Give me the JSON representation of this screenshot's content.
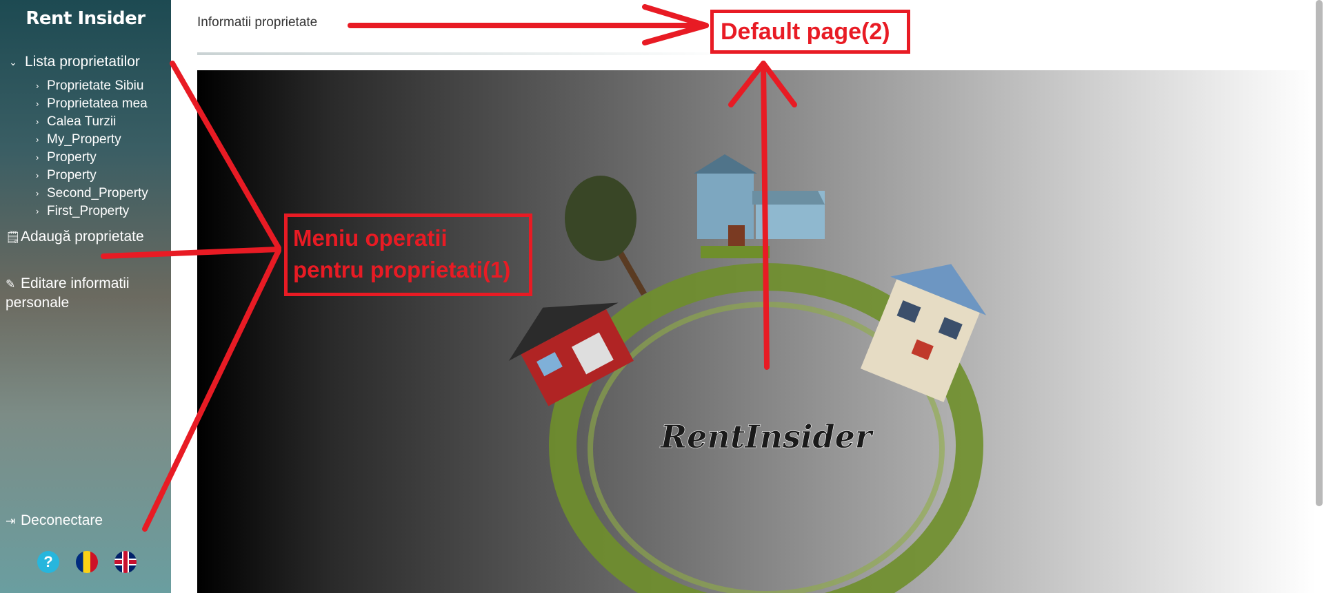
{
  "sidebar": {
    "brand": "Rent Insider",
    "properties_label": "Lista proprietatilor",
    "properties": [
      "Proprietate Sibiu",
      "Proprietatea mea",
      "Calea Turzii",
      "My_Property",
      "Property",
      "Property",
      "Second_Property",
      "First_Property"
    ],
    "add_property": "Adaugă proprietate",
    "edit_personal": "Editare informatii personale",
    "logout": "Deconectare",
    "help_symbol": "?"
  },
  "main": {
    "title": "Informatii proprietate",
    "hero_logo_text": "RentInsider"
  },
  "annotations": {
    "menu_box": "Meniu operatii pentru proprietati(1)",
    "default_box": "Default page(2)"
  },
  "colors": {
    "annotation": "#e81b24",
    "ring": "#6f8f2b"
  }
}
